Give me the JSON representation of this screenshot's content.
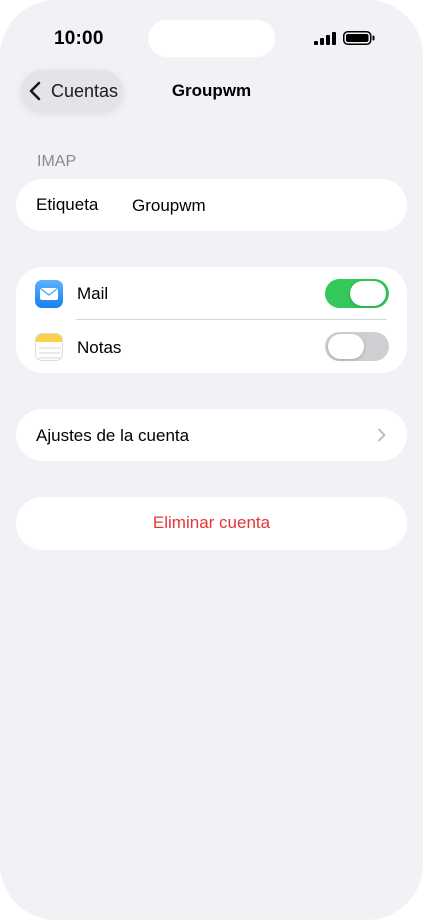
{
  "status_bar": {
    "time": "10:00"
  },
  "nav": {
    "back_label": "Cuentas",
    "title": "Groupwm"
  },
  "section": {
    "header": "IMAP"
  },
  "label_row": {
    "label": "Etiqueta",
    "value": "Groupwm"
  },
  "apps": [
    {
      "label": "Mail",
      "icon": "mail-icon",
      "enabled": true
    },
    {
      "label": "Notas",
      "icon": "notes-icon",
      "enabled": false
    }
  ],
  "settings_row": {
    "label": "Ajustes de la cuenta"
  },
  "delete_row": {
    "label": "Eliminar cuenta"
  },
  "colors": {
    "background": "#f1f1f6",
    "toggle_on": "#34c759",
    "toggle_off": "#cfcfd3",
    "destructive": "#e5353d",
    "secondary_text": "#8a8a8e"
  }
}
